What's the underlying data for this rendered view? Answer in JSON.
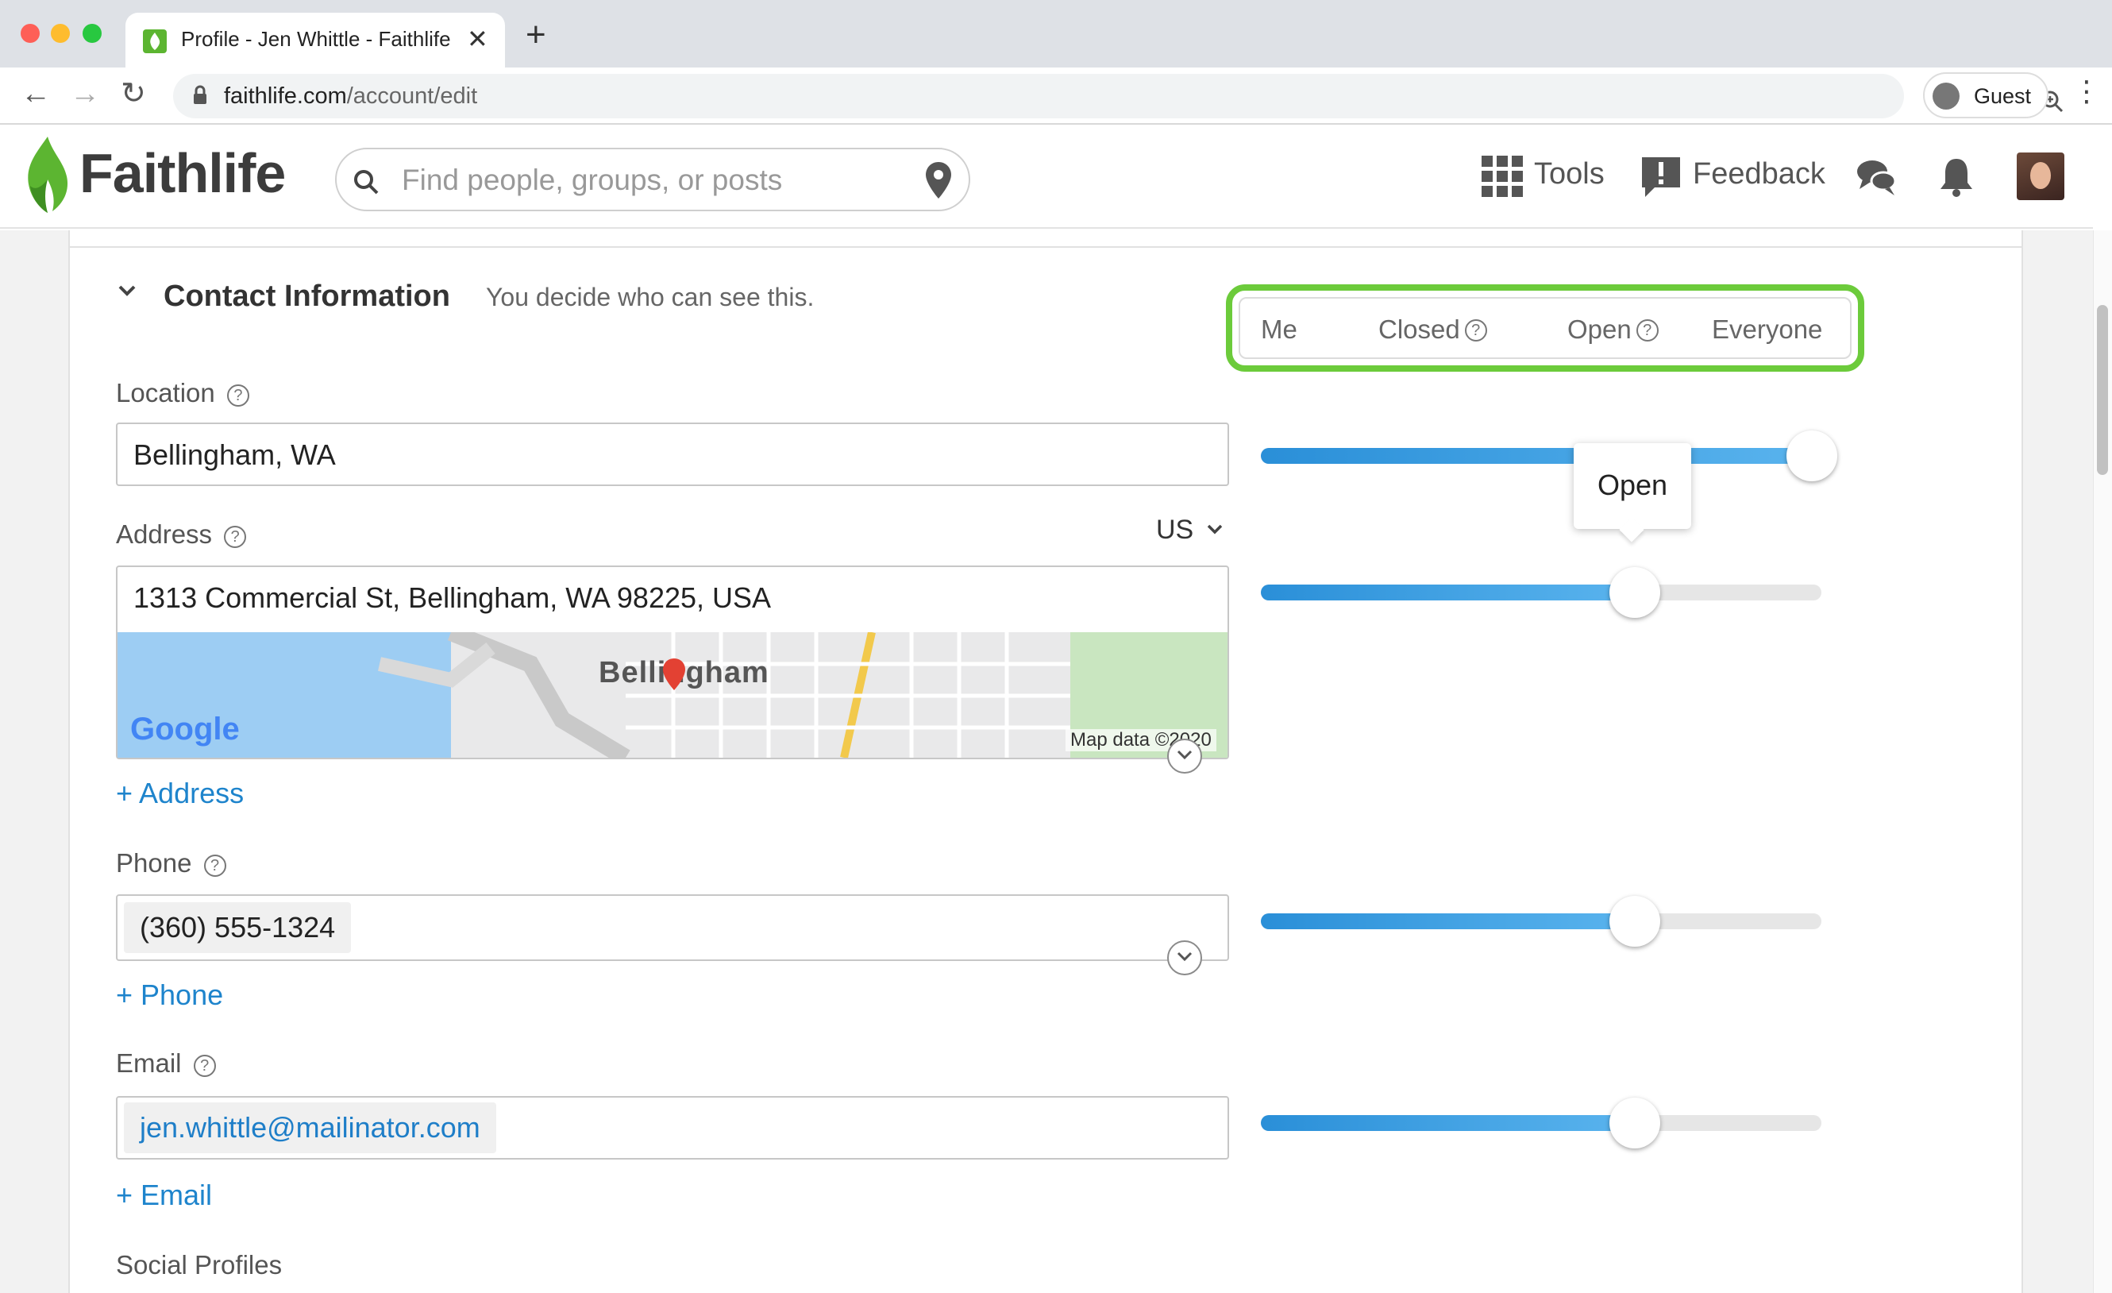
{
  "browser": {
    "tab_title": "Profile - Jen Whittle - Faithlife",
    "url_domain": "faithlife.com",
    "url_path": "/account/edit",
    "profile_label": "Guest"
  },
  "header": {
    "logo_text": "Faithlife",
    "search_placeholder": "Find people, groups, or posts",
    "tools_label": "Tools",
    "feedback_label": "Feedback"
  },
  "section": {
    "title": "Contact Information",
    "subtitle": "You decide who can see this."
  },
  "visibility": {
    "levels": [
      "Me",
      "Closed",
      "Open",
      "Everyone"
    ],
    "tooltip": "Open"
  },
  "fields": {
    "location": {
      "label": "Location",
      "value": "Bellingham, WA",
      "visibility_level": 1.0
    },
    "address": {
      "label": "Address",
      "country": "US",
      "value": "1313 Commercial St, Bellingham, WA 98225, USA",
      "map_city": "Bellingham",
      "map_attribution": "Map data ©2020",
      "map_logo": "Google",
      "add_label": "+ Address",
      "visibility_level": 0.667
    },
    "phone": {
      "label": "Phone",
      "value": "(360) 555-1324",
      "add_label": "+ Phone",
      "visibility_level": 0.667
    },
    "email": {
      "label": "Email",
      "value": "jen.whittle@mailinator.com",
      "add_label": "+ Email",
      "visibility_level": 0.667
    },
    "social": {
      "label": "Social Profiles"
    }
  },
  "colors": {
    "accent": "#1e84cc",
    "highlight": "#6ccb3b",
    "brand_green": "#5cb531"
  }
}
